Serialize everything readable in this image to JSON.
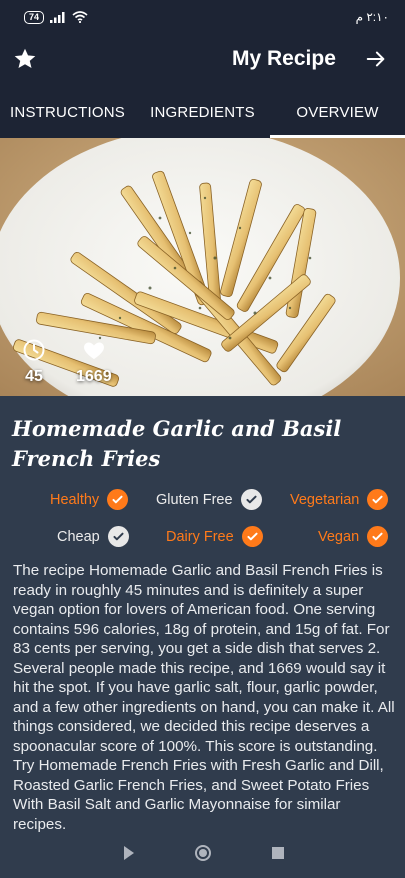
{
  "status_bar": {
    "battery": "74",
    "time": "٢:١٠ م"
  },
  "app_bar": {
    "title": "My Recipe",
    "star_icon": "star-icon",
    "next_icon": "arrow-right-icon"
  },
  "tabs": [
    {
      "label": "INSTRUCTIONS",
      "selected": false
    },
    {
      "label": "INGREDIENTS",
      "selected": false
    },
    {
      "label": "OVERVIEW",
      "selected": true
    }
  ],
  "hero": {
    "ready_minutes": "45",
    "likes": "1669"
  },
  "recipe": {
    "title": "Homemade Garlic and Basil French Fries",
    "tags": [
      {
        "label": "Healthy",
        "active": true
      },
      {
        "label": "Gluten Free",
        "active": false
      },
      {
        "label": "Vegetarian",
        "active": true
      },
      {
        "label": "Cheap",
        "active": false
      },
      {
        "label": "Dairy Free",
        "active": true
      },
      {
        "label": "Vegan",
        "active": true
      }
    ],
    "summary": "The recipe Homemade Garlic and Basil French Fries is ready in roughly 45 minutes and is definitely a super vegan option for lovers of American food. One serving contains 596 calories, 18g of protein, and 15g of fat. For 83 cents per serving, you get a side dish that serves 2. Several people made this recipe, and 1669 would say it hit the spot. If you have garlic salt, flour, garlic powder, and a few other ingredients on hand, you can make it. All things considered, we decided this recipe deserves a spoonacular score of 100%. This score is outstanding. Try Homemade French Fries with Fresh Garlic and Dill, Roasted Garlic French Fries, and Sweet Potato Fries With Basil Salt and Garlic Mayonnaise for similar recipes."
  },
  "colors": {
    "header_bg": "#1d2434",
    "content_bg": "#303c4d",
    "accent": "#ff7a1a"
  }
}
